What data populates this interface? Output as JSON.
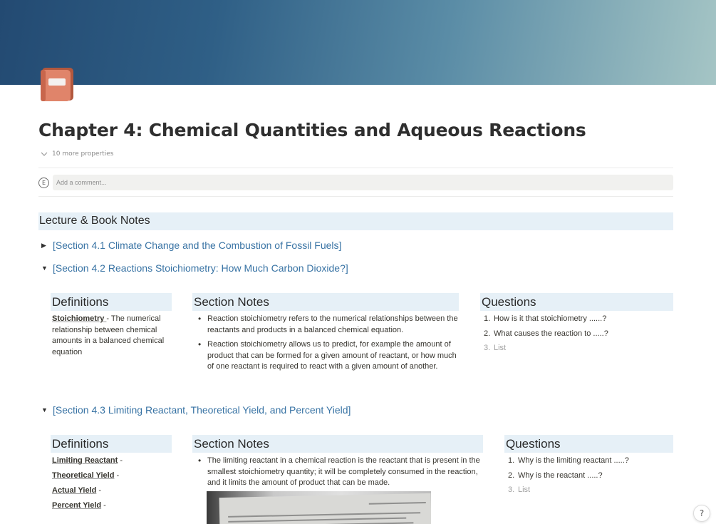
{
  "page": {
    "title": "Chapter 4: Chemical Quantities and Aqueous Reactions",
    "properties_toggle": "10 more properties",
    "comment_avatar": "E",
    "comment_placeholder": "Add a comment...",
    "icon": "book-icon"
  },
  "lecture_heading": "Lecture & Book Notes",
  "sections": [
    {
      "title": "[Section 4.1 Climate Change and the Combustion of Fossil Fuels]",
      "expanded": false,
      "toggle_glyph": "▶"
    },
    {
      "title": "[Section 4.2 Reactions Stoichiometry: How Much Carbon Dioxide?]",
      "expanded": true,
      "toggle_glyph": "▼",
      "definitions_heading": "Definitions",
      "definition_term": "Stoichiometry ",
      "definition_text": "- The numerical relationship between chemical amounts in a balanced chemical equation",
      "notes_heading": "Section Notes",
      "notes": [
        "Reaction stoichiometry refers to the numerical relationships between the reactants and products in a balanced chemical equation.",
        "Reaction stoichiometry allows us to predict, for example the amount of product that can be formed for a given amount of reactant, or how much of one reactant is required to react with a given amount of another."
      ],
      "questions_heading": "Questions",
      "questions": [
        {
          "num": "1.",
          "text": "How is it that stoichiometry ......?"
        },
        {
          "num": "2.",
          "text": "What causes the reaction to .....?"
        },
        {
          "num": "3.",
          "text": "List"
        }
      ]
    },
    {
      "title": "[Section 4.3 Limiting Reactant, Theoretical Yield, and Percent Yield]",
      "expanded": true,
      "toggle_glyph": "▼",
      "definitions_heading": "Definitions",
      "definitions": [
        {
          "term": "Limiting Reactant",
          "dash": " -"
        },
        {
          "term": "Theoretical Yield",
          "dash": " -"
        },
        {
          "term": "Actual Yield",
          "dash": " -"
        },
        {
          "term": "Percent Yield",
          "dash": " -"
        }
      ],
      "notes_heading": "Section Notes",
      "notes": [
        "The limiting reactant in a chemical reaction is the reactant that is present in the smallest stoichiometry quantity; it will be completely consumed in the reaction, and it limits the amount of product that can be made."
      ],
      "questions_heading": "Questions",
      "questions": [
        {
          "num": "1.",
          "text": "Why is the limiting reactant .....?"
        },
        {
          "num": "2.",
          "text": "Why is the reactant .....?"
        },
        {
          "num": "3.",
          "text": "List"
        }
      ]
    }
  ],
  "help_label": "?"
}
